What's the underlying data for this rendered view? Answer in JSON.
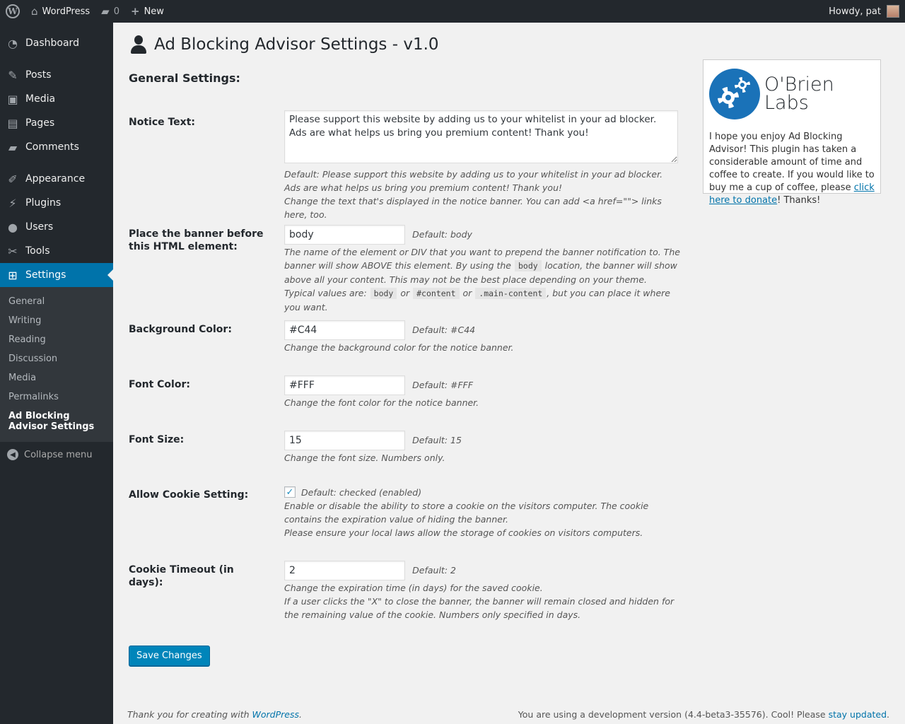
{
  "adminbar": {
    "site_name": "WordPress",
    "comments_count": "0",
    "new_label": "New",
    "howdy": "Howdy, pat"
  },
  "sidebar": {
    "items": [
      {
        "label": "Dashboard",
        "icon": "dashboard-icon"
      },
      {
        "label": "Posts",
        "icon": "pin-icon"
      },
      {
        "label": "Media",
        "icon": "media-icon"
      },
      {
        "label": "Pages",
        "icon": "pages-icon"
      },
      {
        "label": "Comments",
        "icon": "comment-icon"
      },
      {
        "label": "Appearance",
        "icon": "brush-icon"
      },
      {
        "label": "Plugins",
        "icon": "plug-icon"
      },
      {
        "label": "Users",
        "icon": "user-icon"
      },
      {
        "label": "Tools",
        "icon": "wrench-icon"
      },
      {
        "label": "Settings",
        "icon": "settings-icon"
      }
    ],
    "submenu": [
      "General",
      "Writing",
      "Reading",
      "Discussion",
      "Media",
      "Permalinks",
      "Ad Blocking Advisor Settings"
    ],
    "collapse_label": "Collapse menu"
  },
  "page": {
    "title": "Ad Blocking Advisor Settings - v1.0",
    "section_title": "General Settings:"
  },
  "fields": {
    "notice": {
      "label": "Notice Text:",
      "value": "Please support this website by adding us to your whitelist in your ad blocker. Ads are what helps us bring you premium content! Thank you!",
      "desc1": "Default: Please support this website by adding us to your whitelist in your ad blocker. Ads are what helps us bring you premium content! Thank you!",
      "desc2": "Change the text that's displayed in the notice banner. You can add <a href=\"\"> links here, too."
    },
    "element": {
      "label": "Place the banner before this HTML element:",
      "value": "body",
      "default": "Default: body",
      "d1": "The name of the element or DIV that you want to prepend the banner notification to. The banner will show ABOVE this element. By using the",
      "code1": "body",
      "d2": "location, the banner will show above all your content. This may not be the best place depending on your theme. Typical values are:",
      "code2": "body",
      "d3": "or",
      "code3": "#content",
      "d4": "or",
      "code4": ".main-content",
      "d5": ", but you can place it where you want."
    },
    "bg_color": {
      "label": "Background Color:",
      "value": "#C44",
      "default": "Default: #C44",
      "desc": "Change the background color for the notice banner."
    },
    "font_color": {
      "label": "Font Color:",
      "value": "#FFF",
      "default": "Default: #FFF",
      "desc": "Change the font color for the notice banner."
    },
    "font_size": {
      "label": "Font Size:",
      "value": "15",
      "default": "Default: 15",
      "desc": "Change the font size. Numbers only."
    },
    "cookie": {
      "label": "Allow Cookie Setting:",
      "default": "Default: checked (enabled)",
      "desc1": "Enable or disable the ability to store a cookie on the visitors computer. The cookie contains the expiration value of hiding the banner.",
      "desc2": "Please ensure your local laws allow the storage of cookies on visitors computers."
    },
    "timeout": {
      "label": "Cookie Timeout (in days):",
      "value": "2",
      "default": "Default: 2",
      "desc1": "Change the expiration time (in days) for the saved cookie.",
      "desc2": "If a user clicks the \"X\" to close the banner, the banner will remain closed and hidden for the remaining value of the cookie. Numbers only specified in days."
    }
  },
  "save_label": "Save Changes",
  "sidebox": {
    "brand_line1": "O'Brien",
    "brand_line2": "Labs",
    "msg_before": "I hope you enjoy Ad Blocking Advisor! This plugin has taken a considerable amount of time and coffee to create. If you would like to buy me a cup of coffee, please ",
    "donate_link": "click here to donate",
    "msg_after": "! Thanks!"
  },
  "footer": {
    "left_text": "Thank you for creating with ",
    "left_link": "WordPress",
    "left_end": ".",
    "right_text": "You are using a development version (4.4-beta3-35576). Cool! Please ",
    "right_link": "stay updated",
    "right_end": "."
  }
}
